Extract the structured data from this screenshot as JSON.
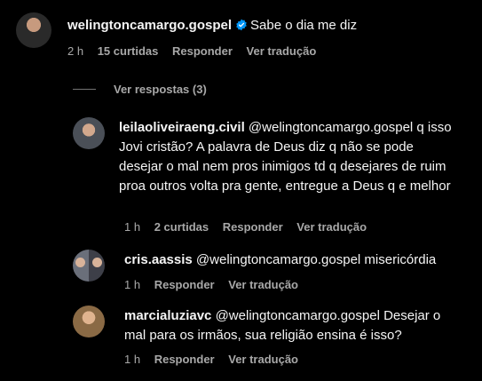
{
  "main_comment": {
    "username": "welingtoncamargo.gospel",
    "text": "Sabe o dia me diz",
    "time": "2 h",
    "likes": "15 curtidas",
    "reply_label": "Responder",
    "translate_label": "Ver tradução"
  },
  "view_replies_label": "Ver respostas (3)",
  "replies": [
    {
      "username": "leilaoliveiraeng.civil",
      "text": "@welingtoncamargo.gospel q isso Jovi cristão? A palavra de Deus diz q não se pode desejar o mal nem pros inimigos td q desejares de ruim proa outros volta pra gente, entregue a Deus q e melhor",
      "time": "1 h",
      "likes": "2 curtidas",
      "reply_label": "Responder",
      "translate_label": "Ver tradução"
    },
    {
      "username": "cris.aassis",
      "text": "@welingtoncamargo.gospel misericórdia",
      "time": "1 h",
      "reply_label": "Responder",
      "translate_label": "Ver tradução"
    },
    {
      "username": "marcialuziavc",
      "text": "@welingtoncamargo.gospel Desejar o mal para os irmãos, sua religião ensina é isso?",
      "time": "1 h",
      "reply_label": "Responder",
      "translate_label": "Ver tradução"
    }
  ],
  "colors": {
    "background": "#000000",
    "text": "#f5f5f5",
    "muted": "#a8a8a8",
    "verified": "#0095f6"
  },
  "icons": {
    "verified": "verified-badge-icon"
  }
}
